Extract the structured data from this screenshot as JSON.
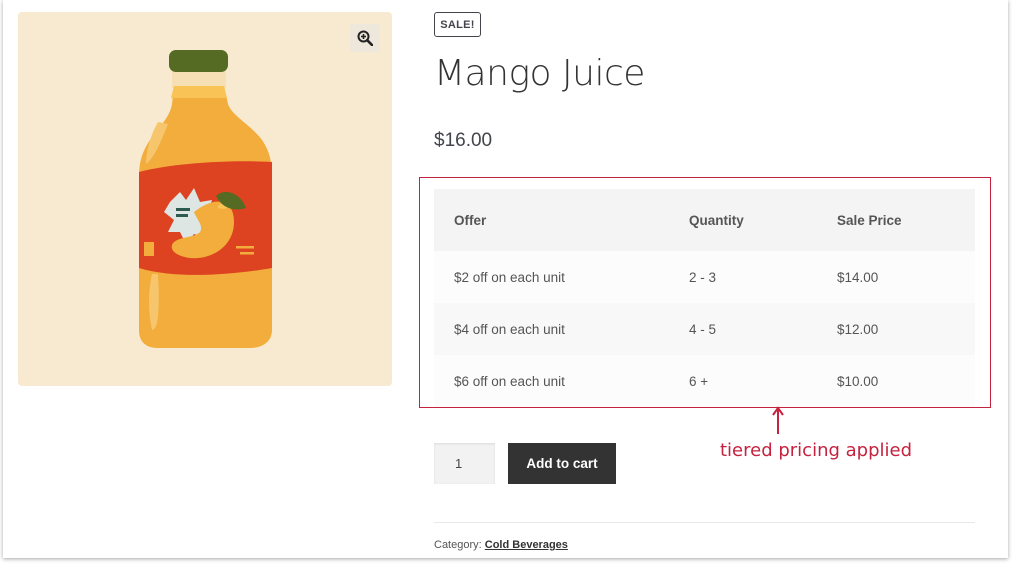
{
  "product": {
    "badge": "SALE!",
    "title": "Mango Juice",
    "price": "$16.00",
    "image_icon": "mango-juice-bottle-image",
    "zoom_icon": "magnify-plus-icon"
  },
  "tiers": {
    "headers": {
      "offer": "Offer",
      "quantity": "Quantity",
      "sale_price": "Sale Price"
    },
    "rows": [
      {
        "offer": "$2 off on each unit",
        "quantity": "2 - 3",
        "sale_price": "$14.00"
      },
      {
        "offer": "$4 off on each unit",
        "quantity": "4 - 5",
        "sale_price": "$12.00"
      },
      {
        "offer": "$6 off on each unit",
        "quantity": "6 +",
        "sale_price": "$10.00"
      }
    ]
  },
  "annotation": {
    "text": "tiered pricing applied"
  },
  "cart": {
    "quantity": "1",
    "add_label": "Add to cart"
  },
  "meta": {
    "category_label": "Category:",
    "category_value": "Cold Beverages"
  },
  "colors": {
    "accent": "#c5223f",
    "button": "#333333",
    "gallery_bg": "#f8ead0",
    "bottle": "#f2ad3c",
    "label": "#dd4320",
    "cap": "#556a22"
  }
}
